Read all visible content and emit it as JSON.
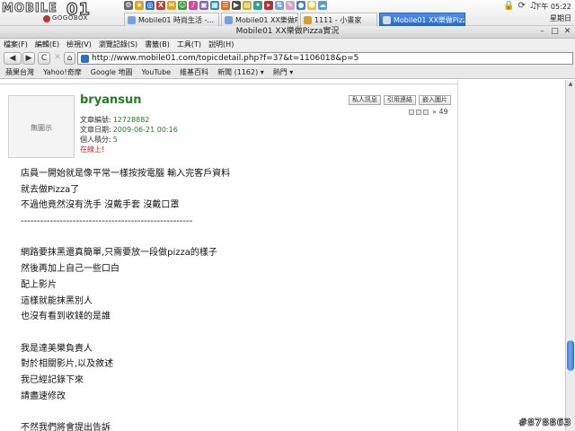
{
  "logo": {
    "word": "MOBILE",
    "number": "01",
    "tagline": "GOGOBOX"
  },
  "tabs": [
    {
      "label": "Mobile01 時尚生活 -...",
      "active": false
    },
    {
      "label": "Mobile01 XX樂做Pizz...",
      "active": false
    },
    {
      "label": "1111 - 小畫家",
      "active": false
    },
    {
      "label": "Mobile01 XX樂做Pizz...",
      "active": true
    }
  ],
  "clock": {
    "time": "下午 05:22",
    "day": "星期日"
  },
  "window": {
    "title": "Mobile01 XX樂做Pizza實況"
  },
  "menu": [
    "檔案(F)",
    "編輯(E)",
    "檢視(V)",
    "瀏覽記錄(S)",
    "書籤(B)",
    "工具(T)",
    "說明(H)"
  ],
  "nav": {
    "back": "◀",
    "forward": "▶",
    "reload": "C",
    "stop": "✕",
    "home": "⌂",
    "url": "http://www.mobile01.com/topicdetail.php?f=37&t=1106018&p=5"
  },
  "bookmarks": [
    "蘋果台灣",
    "Yahoo!奇摩",
    "Google 地圖",
    "YouTube",
    "維基百科",
    "新聞 (1162) ▾",
    "熱門 ▾"
  ],
  "post": {
    "avatar_text": "無圖示",
    "username": "bryansun",
    "meta": [
      {
        "label": "文章編號:",
        "value": "12728882"
      },
      {
        "label": "文章日期:",
        "value": "2009-06-21 00:16"
      },
      {
        "label": "個人積分:",
        "value": "5"
      }
    ],
    "status": "在線上!",
    "buttons": [
      "私人訊息",
      "引用連結",
      "嵌入圖片"
    ],
    "post_number": "49",
    "lines": [
      "店員一開始就是像平常一樣按按電腦 輸入完客戶資料",
      "就去做Pizza了",
      "不過他竟然沒有洗手 沒戴手套 沒戴口罩",
      "-----------------------------------------------------",
      "",
      "網路要抹黑還真簡單,只需要放一段做pizza的樣子",
      "然後再加上自己一些口白",
      "配上影片",
      "這樣就能抹黑別人",
      "也沒有看到收錢的是誰",
      "",
      "我是達美樂負責人",
      "對於相關影片,以及敘述",
      "我已經記錄下來",
      "請盡速修改",
      "",
      "不然我們將會提出告訴"
    ]
  },
  "watermark": "#878863"
}
